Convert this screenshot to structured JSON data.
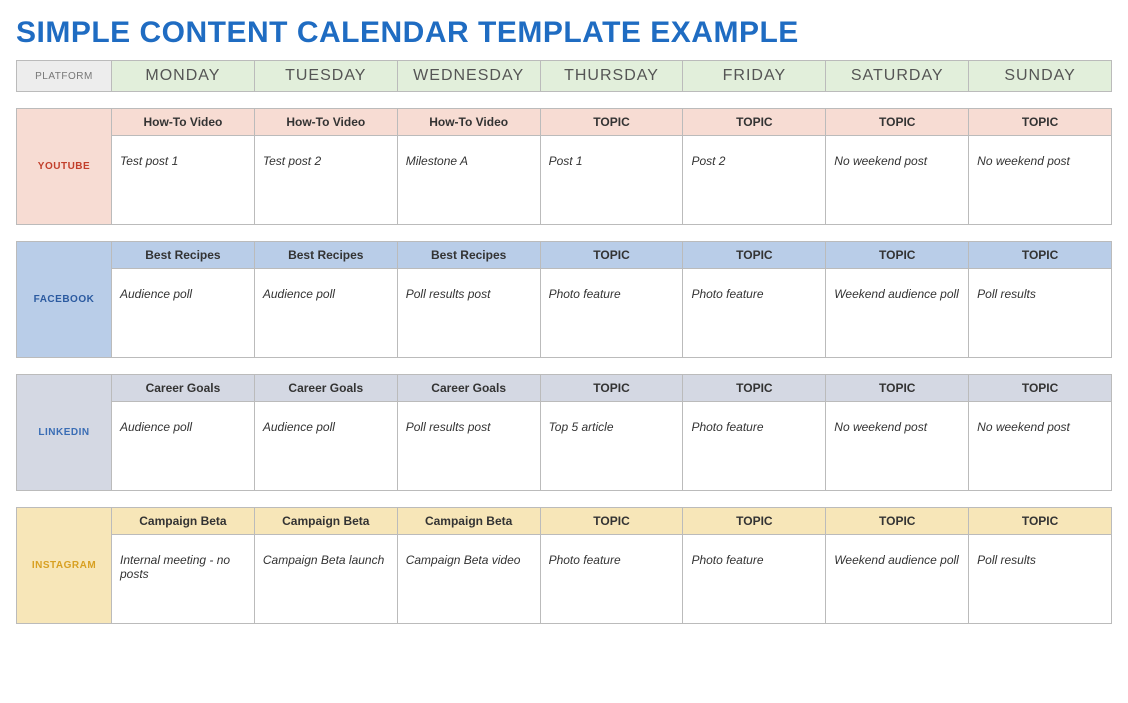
{
  "title": "SIMPLE CONTENT CALENDAR TEMPLATE EXAMPLE",
  "header": {
    "platform_label": "PLATFORM",
    "days": [
      "MONDAY",
      "TUESDAY",
      "WEDNESDAY",
      "THURSDAY",
      "FRIDAY",
      "SATURDAY",
      "SUNDAY"
    ]
  },
  "sections": [
    {
      "key": "youtube",
      "name": "YOUTUBE",
      "topics": [
        "How-To Video",
        "How-To Video",
        "How-To Video",
        "TOPIC",
        "TOPIC",
        "TOPIC",
        "TOPIC"
      ],
      "content": [
        "Test post 1",
        "Test post 2",
        "Milestone A",
        "Post 1",
        "Post 2",
        "No weekend post",
        "No weekend post"
      ]
    },
    {
      "key": "facebook",
      "name": "FACEBOOK",
      "topics": [
        "Best Recipes",
        "Best Recipes",
        "Best Recipes",
        "TOPIC",
        "TOPIC",
        "TOPIC",
        "TOPIC"
      ],
      "content": [
        "Audience poll",
        "Audience poll",
        "Poll results post",
        "Photo feature",
        "Photo feature",
        "Weekend audience poll",
        "Poll results"
      ]
    },
    {
      "key": "linkedin",
      "name": "LINKEDIN",
      "topics": [
        "Career Goals",
        "Career Goals",
        "Career Goals",
        "TOPIC",
        "TOPIC",
        "TOPIC",
        "TOPIC"
      ],
      "content": [
        "Audience poll",
        "Audience poll",
        "Poll results post",
        "Top 5 article",
        "Photo feature",
        "No weekend post",
        "No weekend post"
      ]
    },
    {
      "key": "instagram",
      "name": "INSTAGRAM",
      "topics": [
        "Campaign Beta",
        "Campaign Beta",
        "Campaign Beta",
        "TOPIC",
        "TOPIC",
        "TOPIC",
        "TOPIC"
      ],
      "content": [
        "Internal meeting - no posts",
        "Campaign Beta launch",
        "Campaign Beta video",
        "Photo feature",
        "Photo feature",
        "Weekend audience poll",
        "Poll results"
      ]
    }
  ]
}
